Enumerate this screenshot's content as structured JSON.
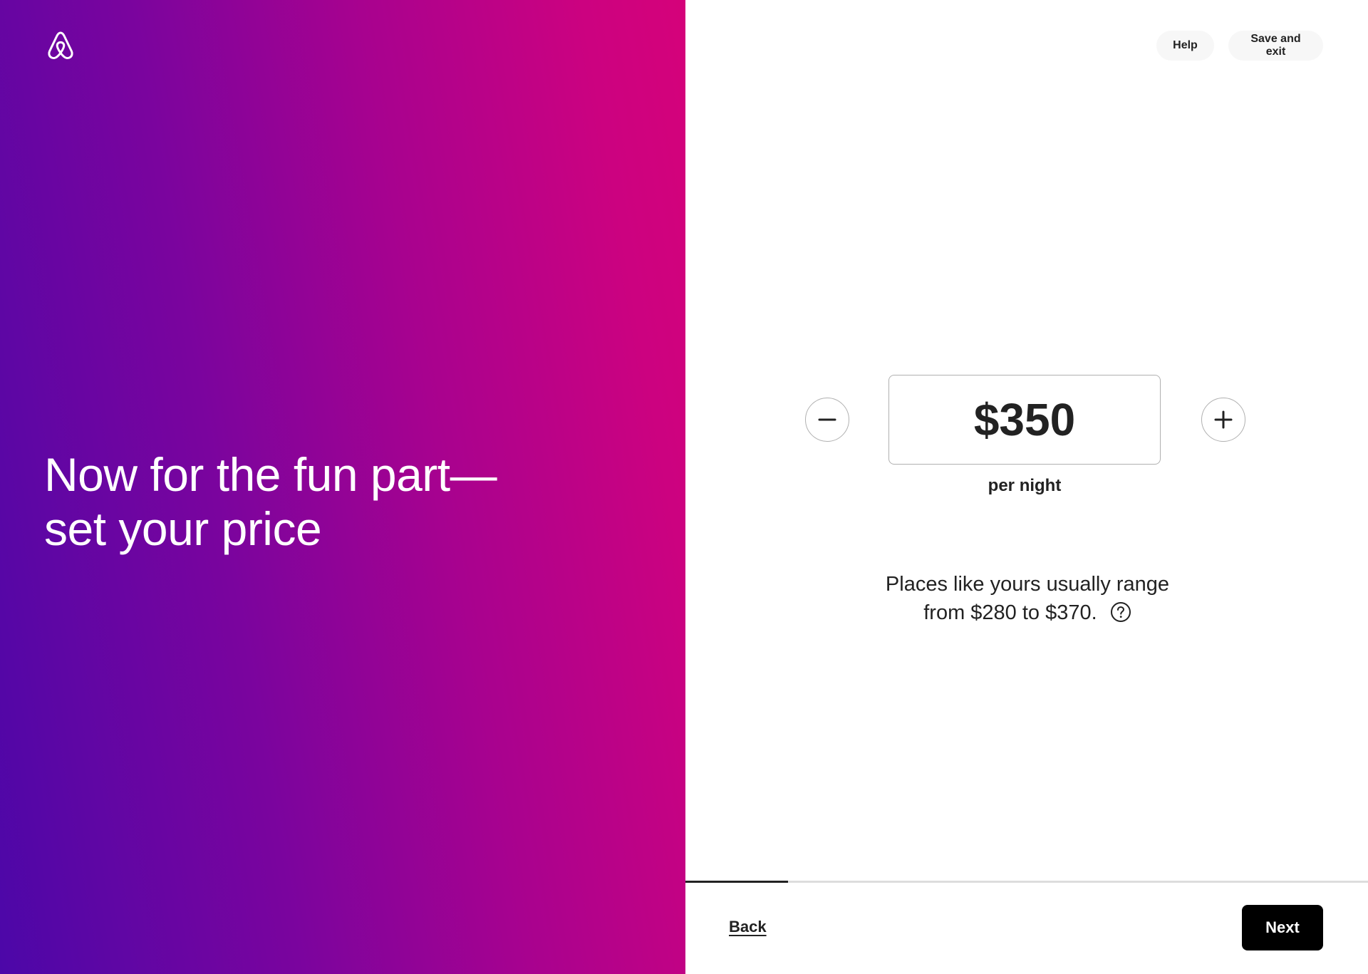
{
  "brand": {
    "logo_icon": "airbnb-logo-icon"
  },
  "header": {
    "help_label": "Help",
    "save_exit_label": "Save and exit"
  },
  "hero": {
    "line1": "Now for the fun part—",
    "line2": "set your price"
  },
  "pricing": {
    "value": "$350",
    "unit_label": "per night",
    "decrease_icon": "minus-icon",
    "increase_icon": "plus-icon",
    "range_line1": "Places like yours usually range",
    "range_line2": "from $280 to $370.",
    "info_icon": "question-circle-icon"
  },
  "footer": {
    "back_label": "Back",
    "next_label": "Next",
    "progress_fraction": 0.15
  },
  "colors": {
    "gradient_start": "#4c07a8",
    "gradient_end": "#d5027a",
    "text": "#222222",
    "primary_button": "#000000",
    "border": "#b0b0b0"
  }
}
